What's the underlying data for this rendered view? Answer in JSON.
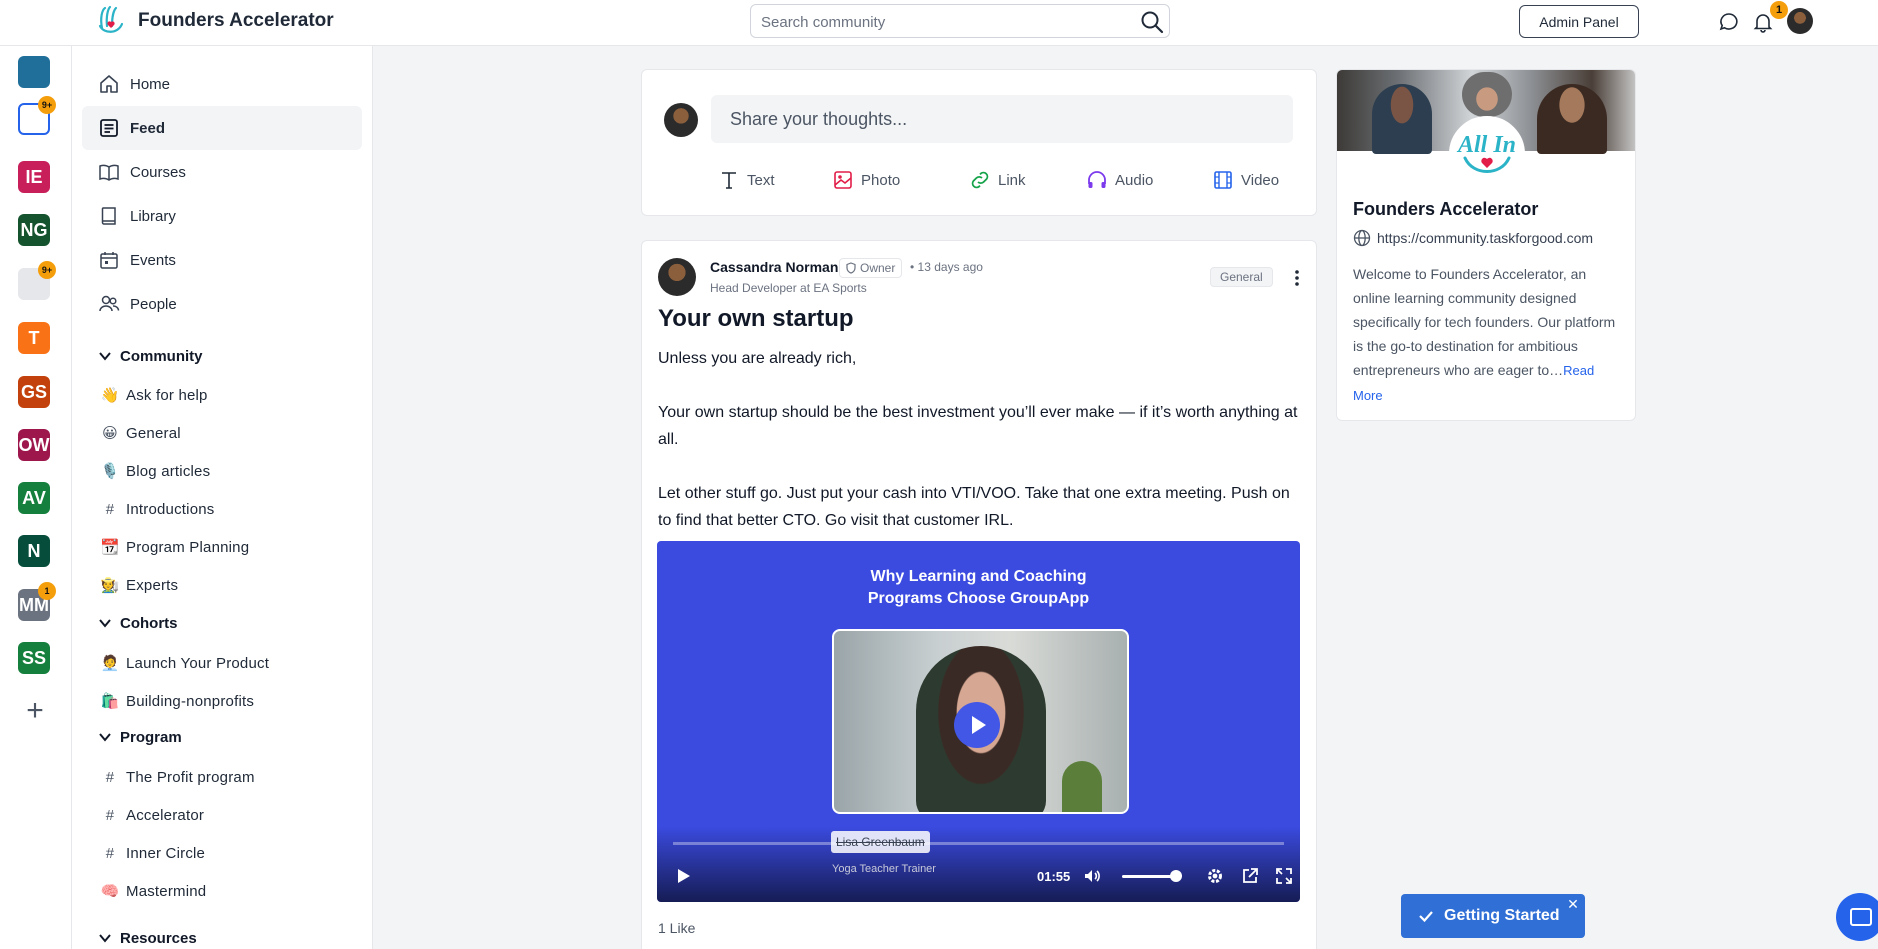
{
  "app": {
    "name": "Founders Accelerator",
    "logo_text": "All In"
  },
  "header": {
    "search_placeholder": "Search community",
    "admin_label": "Admin Panel",
    "notification_count": "1"
  },
  "rail": [
    {
      "label": "",
      "color": "#1f6f9a",
      "badge": ""
    },
    {
      "label": "",
      "color": "#ffffff",
      "badge": "9+"
    },
    {
      "label": "IE",
      "color": "#c81e5a",
      "badge": ""
    },
    {
      "label": "NG",
      "color": "#14532d",
      "badge": ""
    },
    {
      "label": "",
      "color": "#e5e7eb",
      "badge": "9+"
    },
    {
      "label": "T",
      "color": "#f97316",
      "badge": ""
    },
    {
      "label": "GS",
      "color": "#c2410c",
      "badge": ""
    },
    {
      "label": "OW",
      "color": "#9d174d",
      "badge": ""
    },
    {
      "label": "AV",
      "color": "#15803d",
      "badge": ""
    },
    {
      "label": "N",
      "color": "#064e3b",
      "badge": ""
    },
    {
      "label": "MM",
      "color": "#6b7280",
      "badge": "1"
    },
    {
      "label": "SS",
      "color": "#15803d",
      "badge": ""
    }
  ],
  "nav": {
    "home": "Home",
    "feed": "Feed",
    "courses": "Courses",
    "library": "Library",
    "events": "Events",
    "people": "People"
  },
  "sections": {
    "community": {
      "title": "Community",
      "channels": [
        {
          "icon": "👋",
          "label": "Ask for help"
        },
        {
          "icon": "😀",
          "label": "General"
        },
        {
          "icon": "🎙️",
          "label": "Blog articles"
        },
        {
          "icon": "#",
          "label": "Introductions"
        },
        {
          "icon": "📆",
          "label": "Program Planning"
        },
        {
          "icon": "🧑‍🌾",
          "label": "Experts"
        }
      ]
    },
    "cohorts": {
      "title": "Cohorts",
      "channels": [
        {
          "icon": "🧑‍💼",
          "label": "Launch Your Product"
        },
        {
          "icon": "🛍️",
          "label": "Building-nonprofits"
        }
      ]
    },
    "program": {
      "title": "Program",
      "channels": [
        {
          "icon": "#",
          "label": "The Profit program"
        },
        {
          "icon": "#",
          "label": "Accelerator"
        },
        {
          "icon": "#",
          "label": "Inner Circle"
        },
        {
          "icon": "🧠",
          "label": "Mastermind"
        }
      ]
    },
    "resources": {
      "title": "Resources"
    }
  },
  "composer": {
    "placeholder": "Share your thoughts...",
    "actions": {
      "text": "Text",
      "photo": "Photo",
      "link": "Link",
      "audio": "Audio",
      "video": "Video"
    }
  },
  "post": {
    "author": "Cassandra Norman",
    "badge": "Owner",
    "time": "• 13 days ago",
    "role": "Head Developer at EA Sports",
    "tag": "General",
    "title": "Your own startup",
    "paragraphs": [
      "Unless you are already rich,",
      "Your own startup should be the best investment you’ll ever make — if it’s worth anything at all.",
      "Let other stuff go. Just put your cash into VTI/VOO. Take that one extra meeting. Push on to find that better CTO. Go visit that customer IRL."
    ],
    "video": {
      "title_line1": "Why Learning and Coaching",
      "title_line2": "Programs Choose GroupApp",
      "speaker_name": "Lisa Greenbaum",
      "speaker_role": "Yoga Teacher Trainer",
      "time": "01:55",
      "volume_level": 0.9
    },
    "likes": "1 Like"
  },
  "about": {
    "name": "Founders Accelerator",
    "url": "https://community.taskforgood.com",
    "description": "Welcome to Founders Accelerator, an online learning community designed specifically for tech founders. Our platform is the go-to destination for ambitious entrepreneurs who are eager to…",
    "read_more": "Read More"
  },
  "getting_started": {
    "label": "Getting Started"
  },
  "colors": {
    "accent": "#2f6fd6",
    "video_bg": "#3b4be0",
    "badge": "#f59e0b",
    "photo_icon": "#e11d48",
    "link_icon": "#16a34a",
    "audio_icon": "#7c3aed",
    "video_icon": "#2563eb"
  }
}
